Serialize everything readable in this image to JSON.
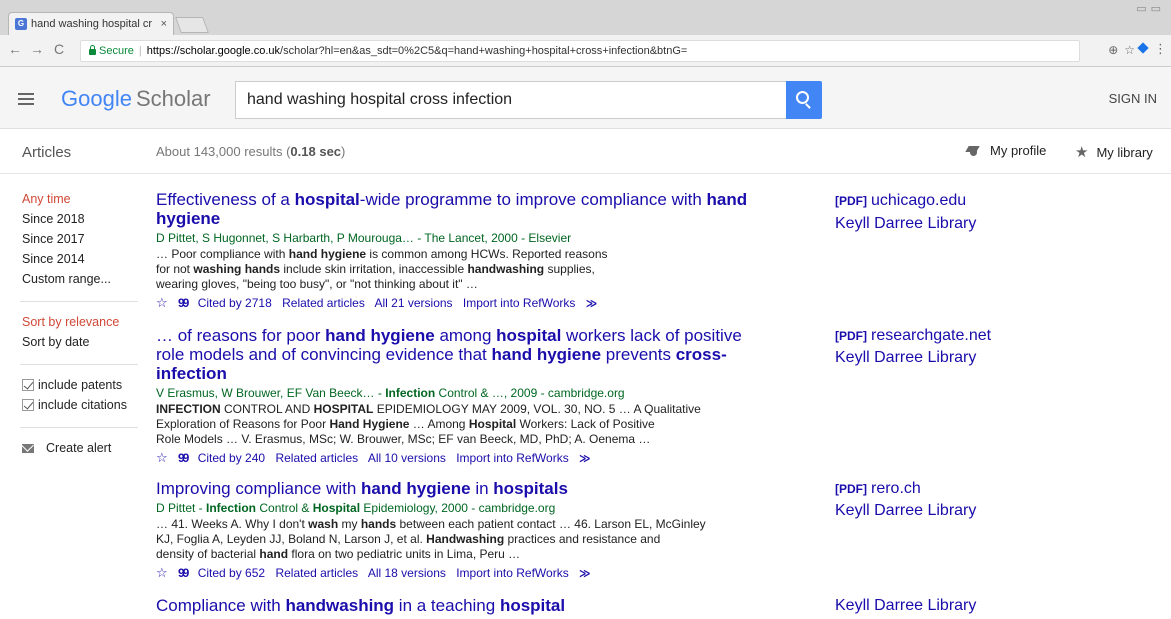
{
  "browser": {
    "tab_title": "hand washing hospital cr",
    "tab_favicon": "G",
    "close_glyph": "×",
    "secure_label": "Secure",
    "url_host": "https://scholar.google.co.uk",
    "url_path": "/scholar?hl=en&as_sdt=0%2C5&q=hand+washing+hospital+cross+infection&btnG="
  },
  "header": {
    "logo_google": "Google",
    "logo_scholar": "Scholar",
    "search_value": "hand washing hospital cross infection",
    "sign_in": "SIGN IN"
  },
  "bar": {
    "articles": "Articles",
    "results_prefix": "About 143,000 results (",
    "results_time": "0.18 sec",
    "results_suffix": ")",
    "my_profile": "My profile",
    "my_library": "My library"
  },
  "sidebar": {
    "time_filters": [
      "Any time",
      "Since 2018",
      "Since 2017",
      "Since 2014",
      "Custom range..."
    ],
    "sort": [
      "Sort by relevance",
      "Sort by date"
    ],
    "checks": [
      "include patents",
      "include citations"
    ],
    "create_alert": "Create alert"
  },
  "results": [
    {
      "authors": "D Pittet, S Hugonnet, S Harbarth, P Mourouga… - The Lancet, 2000 - Elsevier",
      "cited_by": "Cited by 2718",
      "related": "Related articles",
      "versions": "All 21 versions",
      "import": "Import into RefWorks",
      "side_source": "uchicago.edu",
      "side_library": "Keyll Darree Library"
    },
    {
      "cited_by": "Cited by 240",
      "related": "Related articles",
      "versions": "All 10 versions",
      "import": "Import into RefWorks",
      "side_source": "researchgate.net",
      "side_library": "Keyll Darree Library"
    },
    {
      "cited_by": "Cited by 652",
      "related": "Related articles",
      "versions": "All 18 versions",
      "import": "Import into RefWorks",
      "side_source": "rero.ch",
      "side_library": "Keyll Darree Library"
    },
    {
      "side_library": "Keyll Darree Library"
    }
  ],
  "pdf_tag": "[PDF]"
}
